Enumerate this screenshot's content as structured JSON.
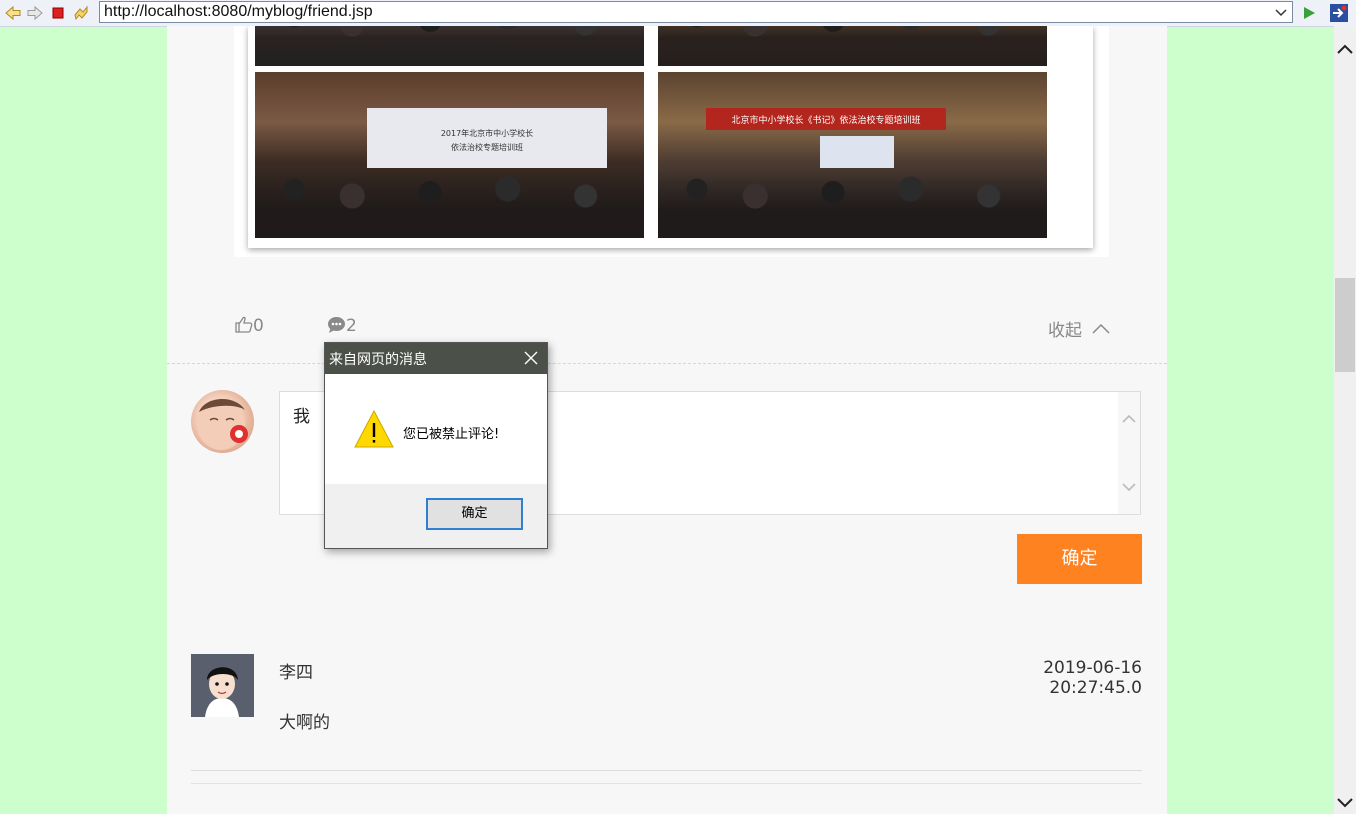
{
  "browser": {
    "url": "http://localhost:8080/myblog/friend.jsp",
    "accent": "#ccffcc"
  },
  "post": {
    "like_count": "0",
    "comment_count": "2",
    "collapse_label": "收起"
  },
  "comment_form": {
    "input_value": "我",
    "submit_label": "确定",
    "submit_color": "#ff8221"
  },
  "comments": [
    {
      "author": "李四",
      "time": "2019-06-16 20:27:45.0",
      "text": "大啊的"
    }
  ],
  "dialog": {
    "title": "来自网页的消息",
    "message": "您已被禁止评论!",
    "ok_label": "确定",
    "icon": "warning-icon"
  },
  "photos": {
    "p3_title": "2017年北京市中小学校长",
    "p3_subtitle": "依法治校专题培训班",
    "p4_banner": "北京市中小学校长《书记》依法治校专题培训班"
  }
}
